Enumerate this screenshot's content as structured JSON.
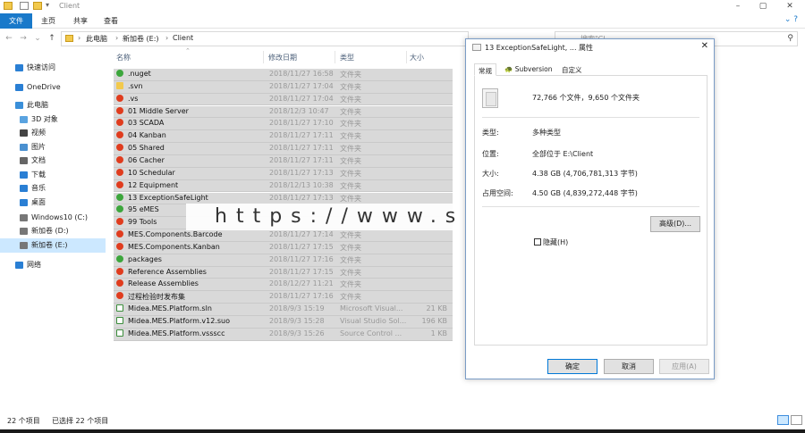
{
  "window": {
    "title": "Client",
    "controls": [
      "–",
      "▢",
      "✕"
    ]
  },
  "ribbon": {
    "tabs": [
      "文件",
      "主页",
      "共享",
      "查看"
    ],
    "help_icon": "help-icon"
  },
  "nav": {
    "back": "←",
    "forward": "→",
    "recent": "⌄",
    "up": "↑",
    "path": [
      "此电脑",
      "新加卷 (E:)",
      "Client"
    ],
    "search_placeholder": "搜索\"Cl..."
  },
  "sidebar": {
    "items": [
      {
        "label": "快速访问",
        "icon": "star-icon",
        "color": "#2a7fd4"
      },
      {
        "label": "OneDrive",
        "icon": "cloud-icon",
        "color": "#2a7fd4"
      },
      {
        "label": "此电脑",
        "icon": "computer-icon",
        "color": "#3a8fd9"
      },
      {
        "label": "3D 对象",
        "icon": "cube-icon",
        "color": "#5aa3e0"
      },
      {
        "label": "视频",
        "icon": "video-icon",
        "color": "#444"
      },
      {
        "label": "图片",
        "icon": "pictures-icon",
        "color": "#4a90d0"
      },
      {
        "label": "文档",
        "icon": "documents-icon",
        "color": "#666"
      },
      {
        "label": "下载",
        "icon": "download-icon",
        "color": "#2a7fd4"
      },
      {
        "label": "音乐",
        "icon": "music-icon",
        "color": "#2a7fd4"
      },
      {
        "label": "桌面",
        "icon": "desktop-icon",
        "color": "#2a7fd4"
      },
      {
        "label": "Windows10 (C:)",
        "icon": "drive-icon",
        "color": "#777"
      },
      {
        "label": "新加卷 (D:)",
        "icon": "drive-icon",
        "color": "#777"
      },
      {
        "label": "新加卷 (E:)",
        "icon": "drive-icon",
        "color": "#777"
      },
      {
        "label": "网络",
        "icon": "network-icon",
        "color": "#2a7fd4"
      }
    ]
  },
  "filelist": {
    "columns": [
      "名称",
      "修改日期",
      "类型",
      "大小"
    ],
    "rows": [
      {
        "name": ".nuget",
        "date": "2018/11/27 16:58",
        "type": "文件夹",
        "size": "",
        "status": "green"
      },
      {
        "name": ".svn",
        "date": "2018/11/27 17:04",
        "type": "文件夹",
        "size": "",
        "status": "yellow"
      },
      {
        "name": ".vs",
        "date": "2018/11/27 17:04",
        "type": "文件夹",
        "size": "",
        "status": "red"
      },
      {
        "name": "01 Middle Server",
        "date": "2018/12/3 10:47",
        "type": "文件夹",
        "size": "",
        "status": "red"
      },
      {
        "name": "03 SCADA",
        "date": "2018/11/27 17:10",
        "type": "文件夹",
        "size": "",
        "status": "red"
      },
      {
        "name": "04 Kanban",
        "date": "2018/11/27 17:11",
        "type": "文件夹",
        "size": "",
        "status": "red"
      },
      {
        "name": "05 Shared",
        "date": "2018/11/27 17:11",
        "type": "文件夹",
        "size": "",
        "status": "red"
      },
      {
        "name": "06 Cacher",
        "date": "2018/11/27 17:11",
        "type": "文件夹",
        "size": "",
        "status": "red"
      },
      {
        "name": "10 Schedular",
        "date": "2018/11/27 17:13",
        "type": "文件夹",
        "size": "",
        "status": "red"
      },
      {
        "name": "12 Equipment",
        "date": "2018/12/13 10:38",
        "type": "文件夹",
        "size": "",
        "status": "red"
      },
      {
        "name": "13 ExceptionSafeLight",
        "date": "2018/11/27 17:13",
        "type": "文件夹",
        "size": "",
        "status": "green"
      },
      {
        "name": "95 eMES",
        "date": "",
        "type": "",
        "size": "",
        "status": "green"
      },
      {
        "name": "99 Tools",
        "date": "",
        "type": "",
        "size": "",
        "status": "red"
      },
      {
        "name": "MES.Components.Barcode",
        "date": "2018/11/27 17:14",
        "type": "文件夹",
        "size": "",
        "status": "red"
      },
      {
        "name": "MES.Components.Kanban",
        "date": "2018/11/27 17:15",
        "type": "文件夹",
        "size": "",
        "status": "red"
      },
      {
        "name": "packages",
        "date": "2018/11/27 17:16",
        "type": "文件夹",
        "size": "",
        "status": "green"
      },
      {
        "name": "Reference Assemblies",
        "date": "2018/11/27 17:15",
        "type": "文件夹",
        "size": "",
        "status": "red"
      },
      {
        "name": "Release Assemblies",
        "date": "2018/12/27 11:21",
        "type": "文件夹",
        "size": "",
        "status": "red"
      },
      {
        "name": "过程检验时发布集",
        "date": "2018/11/27 17:16",
        "type": "文件夹",
        "size": "",
        "status": "red"
      },
      {
        "name": "Midea.MES.Platform.sln",
        "date": "2018/9/3 15:19",
        "type": "Microsoft Visual...",
        "size": "21 KB",
        "status": "doc"
      },
      {
        "name": "Midea.MES.Platform.v12.suo",
        "date": "2018/9/3 15:28",
        "type": "Visual Studio Sol...",
        "size": "196 KB",
        "status": "doc"
      },
      {
        "name": "Midea.MES.Platform.vssscc",
        "date": "2018/9/3 15:26",
        "type": "Source Control ...",
        "size": "1 KB",
        "status": "doc"
      }
    ]
  },
  "status": {
    "count": "22 个项目",
    "selected": "已选择 22 个项目"
  },
  "dialog": {
    "title": "13 ExceptionSafeLight, ... 属性",
    "close": "✕",
    "tabs": [
      "常规",
      "Subversion",
      "自定义"
    ],
    "summary": "72,766 个文件，9,650 个文件夹",
    "props": [
      {
        "key": "类型:",
        "value": "多种类型"
      },
      {
        "key": "位置:",
        "value": "全部位于 E:\\Client"
      },
      {
        "key": "大小:",
        "value": "4.38 GB (4,706,781,313 字节)"
      },
      {
        "key": "占用空间:",
        "value": "4.50 GB (4,839,272,448 字节)"
      }
    ],
    "advanced_button": "高级(D)...",
    "attr_hidden": "隐藏(H)",
    "buttons": {
      "ok": "确定",
      "cancel": "取消",
      "apply": "应用(A)"
    }
  },
  "watermark": "https://www.songma.com"
}
